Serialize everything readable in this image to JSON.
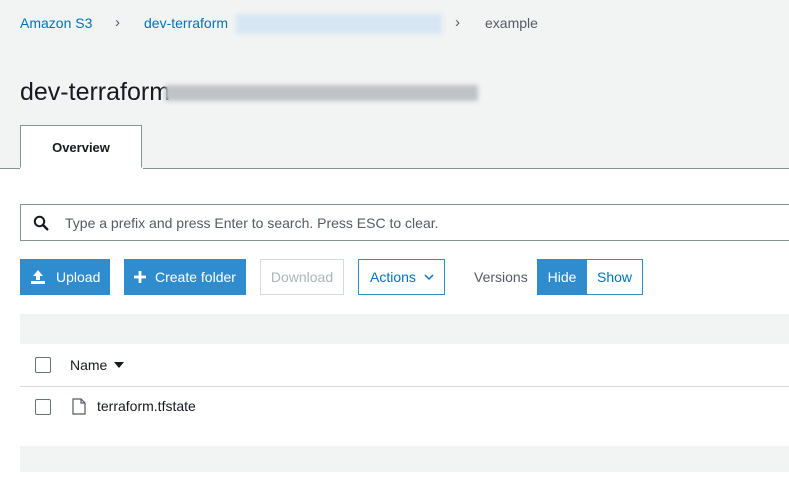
{
  "breadcrumb": {
    "root": "Amazon S3",
    "bucket": "dev-terraform",
    "current": "example"
  },
  "page": {
    "title": "dev-terraform-"
  },
  "tabs": [
    {
      "label": "Overview",
      "active": true
    }
  ],
  "search": {
    "placeholder": "Type a prefix and press Enter to search. Press ESC to clear."
  },
  "toolbar": {
    "upload": "Upload",
    "create_folder": "Create folder",
    "download": "Download",
    "actions": "Actions",
    "versions_label": "Versions",
    "hide": "Hide",
    "show": "Show"
  },
  "table": {
    "columns": [
      {
        "label": "Name",
        "sort": "desc"
      }
    ],
    "rows": [
      {
        "name": "terraform.tfstate",
        "type": "file"
      }
    ]
  },
  "colors": {
    "primary": "#2e8ccf",
    "link": "#0073bb",
    "border": "#879596",
    "background": "#f2f3f3"
  }
}
